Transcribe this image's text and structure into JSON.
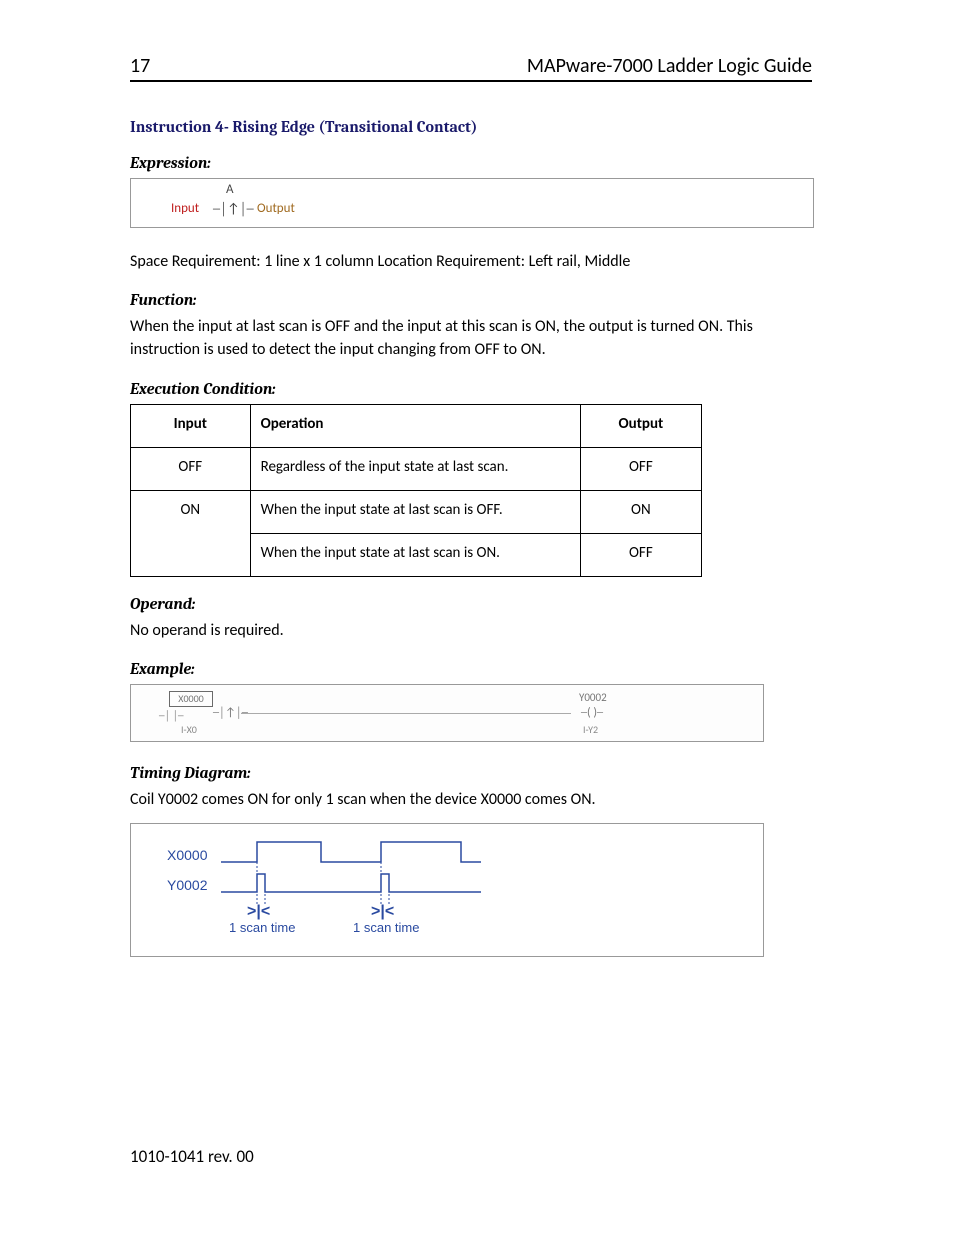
{
  "header": {
    "page_number": "17",
    "doc_title": "MAPware-7000 Ladder Logic Guide"
  },
  "section_title": "Instruction 4- Rising Edge (Transitional Contact)",
  "expression": {
    "heading": "Expression:",
    "label_a": "A",
    "label_input": "Input",
    "label_output": "Output",
    "symbol": "─│↑│─"
  },
  "space_loc": "Space Requirement: 1 line x 1 column      Location Requirement: Left rail, Middle",
  "function": {
    "heading": "Function:",
    "text": "When the input at last scan is OFF and the input at this scan is ON, the output is turned ON.  This instruction is used to detect the input changing from OFF to ON."
  },
  "exec": {
    "heading": "Execution Condition:",
    "head_input": "Input",
    "head_operation": "Operation",
    "head_output": "Output",
    "rows": [
      {
        "input": "OFF",
        "operation": "Regardless of the input state at last scan.",
        "output": "OFF"
      },
      {
        "input": "ON",
        "operation": "When the input state at last scan is OFF.",
        "output": "ON"
      },
      {
        "input": "",
        "operation": "When the input state at last scan is ON.",
        "output": "OFF"
      }
    ]
  },
  "operand": {
    "heading": "Operand:",
    "text": "No operand is required."
  },
  "example": {
    "heading": "Example:",
    "left_tag": "X0000",
    "left_sub": "I-X0",
    "right_tag": "Y0002",
    "right_sub": "I-Y2",
    "contact": "─│ │─",
    "rising": "─│↑│─",
    "coil": "─( )─"
  },
  "timing": {
    "heading": "Timing Diagram:",
    "text": "Coil Y0002 comes ON for only 1 scan when the device X0000 comes ON.",
    "sig1": "X0000",
    "sig2": "Y0002",
    "scan_label": "1 scan time"
  },
  "footer": "1010-1041 rev. 00"
}
